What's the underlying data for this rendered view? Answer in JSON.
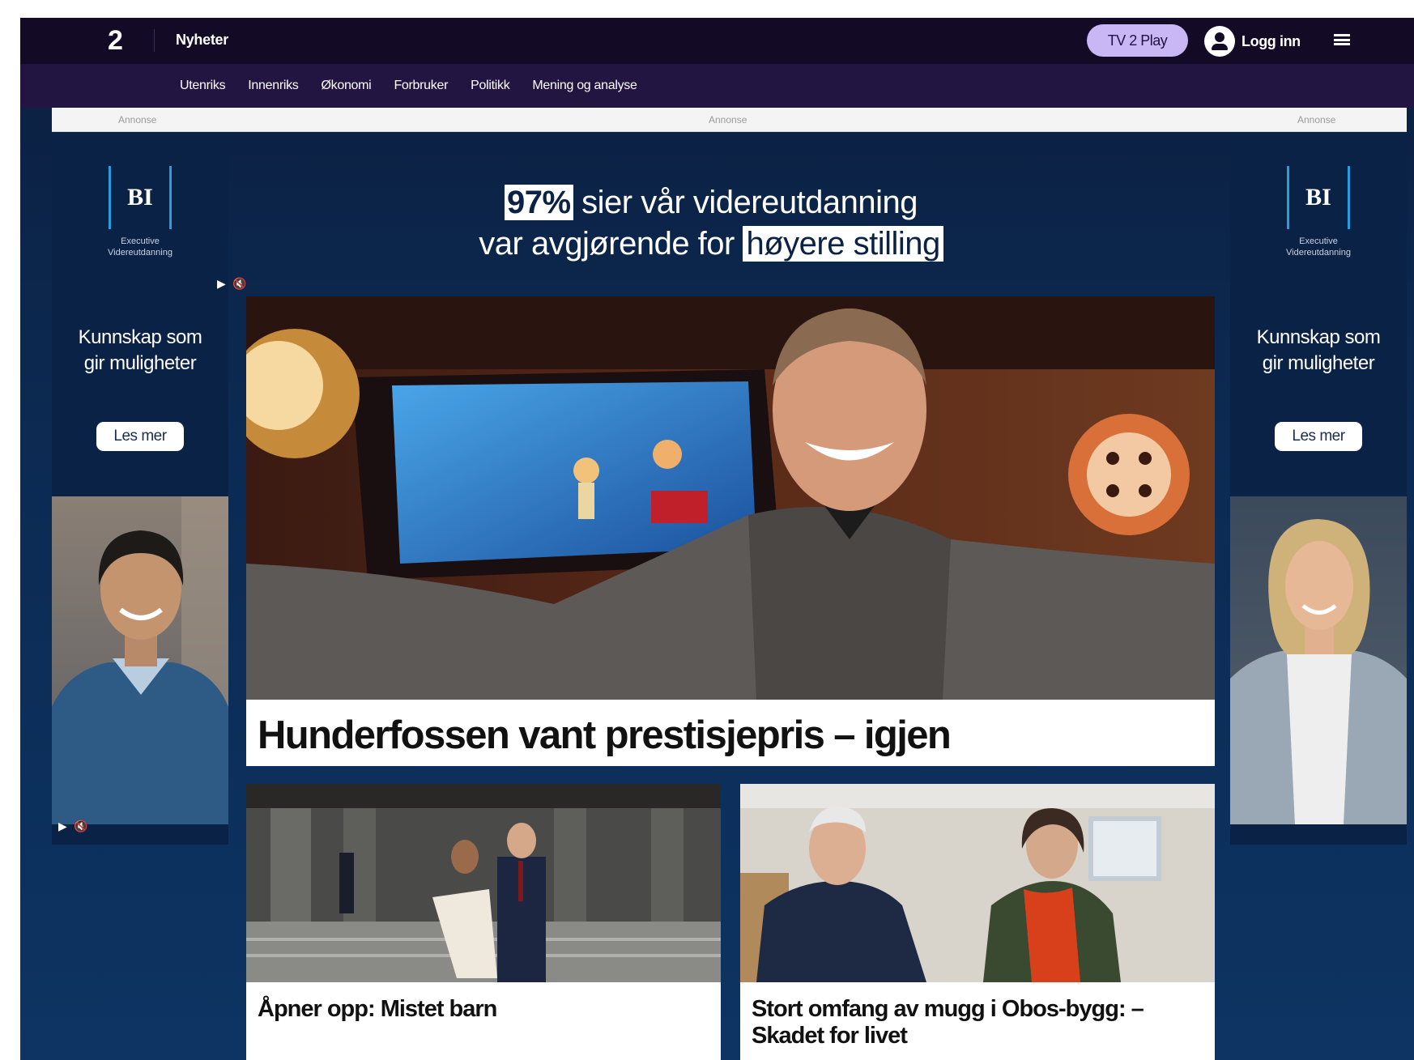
{
  "header": {
    "logo": "2",
    "section": "Nyheter",
    "tv2play_label": "TV 2 Play",
    "login_label": "Logg inn"
  },
  "subnav": {
    "items": [
      "Utenriks",
      "Innenriks",
      "Økonomi",
      "Forbruker",
      "Politikk",
      "Mening og analyse"
    ]
  },
  "ads": {
    "annonse_label": "Annonse",
    "bi_logo": "BI",
    "bi_sub": "Executive\nVidereutdanning",
    "slogan": "Kunnskap som\ngir muligheter",
    "cta": "Les mer",
    "media_controls": "▶ 🔇",
    "banner": {
      "percent": "97%",
      "line1_rest": " sier vår videreutdanning",
      "line2_pre": "var avgjørende for ",
      "line2_highlight": "høyere stilling"
    }
  },
  "articles": {
    "main": {
      "headline": "Hunderfossen vant prestisjepris – igjen"
    },
    "left": {
      "headline": "Åpner opp: Mistet barn"
    },
    "right": {
      "headline": "Stort omfang av mugg i Obos-bygg: – Skadet for livet"
    }
  }
}
